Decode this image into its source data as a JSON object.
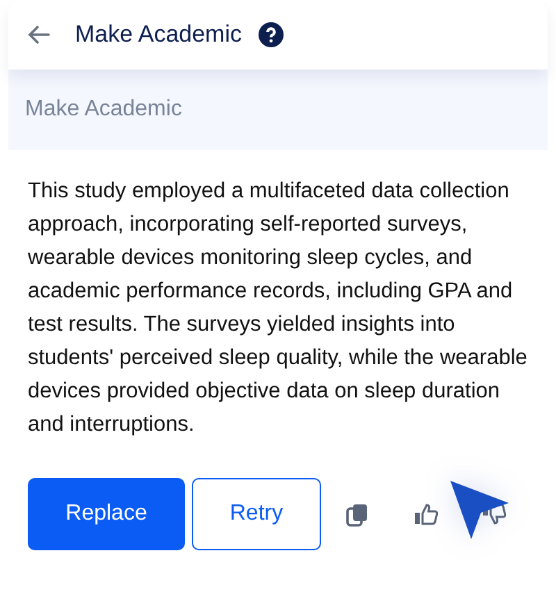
{
  "header": {
    "title": "Make Academic"
  },
  "input": {
    "placeholder": "Make Academic"
  },
  "result": {
    "text": "This study employed a multifaceted data collection approach, incorporating self-reported surveys, wearable devices monitoring sleep cycles, and academic performance records, including GPA and test results. The surveys yielded insights into students' perceived sleep quality, while the wearable devices provided objective data on sleep duration and interruptions."
  },
  "buttons": [
    {
      "label": "Replace",
      "kind": "primary"
    },
    {
      "label": "Retry",
      "kind": "outline"
    }
  ]
}
